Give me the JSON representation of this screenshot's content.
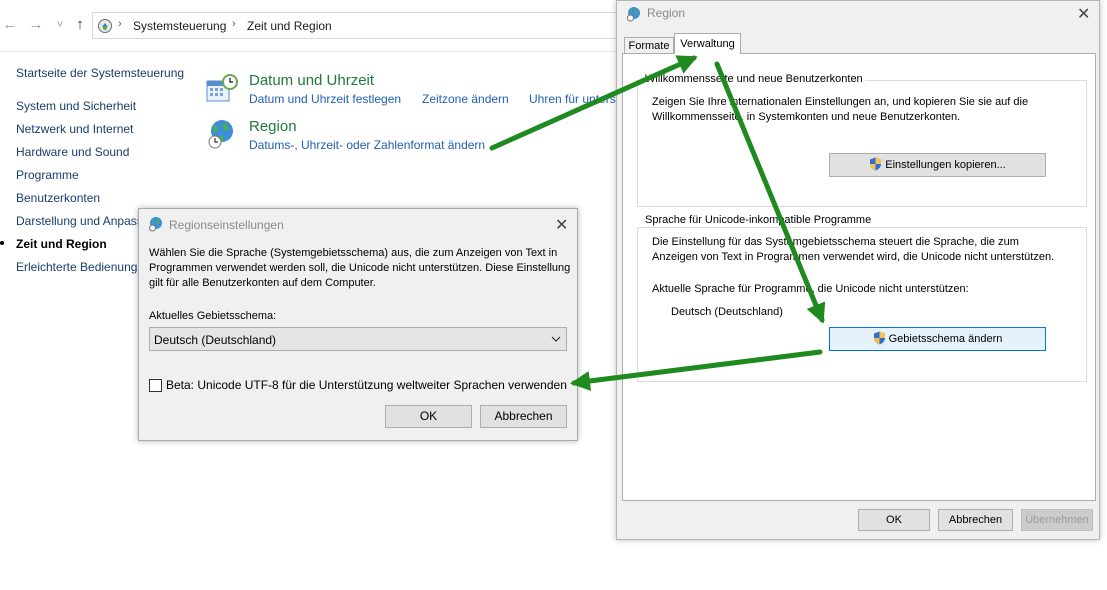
{
  "explorer": {
    "breadcrumb": [
      "Systemsteuerung",
      "Zeit und Region"
    ],
    "nav": {
      "back": "←",
      "forward": "→",
      "recent": "˅",
      "up": "↑"
    }
  },
  "sidebar": {
    "home": "Startseite der Systemsteuerung",
    "items": [
      "System und Sicherheit",
      "Netzwerk und Internet",
      "Hardware und Sound",
      "Programme",
      "Benutzerkonten",
      "Darstellung und Anpassung",
      "Zeit und Region",
      "Erleichterte Bedienung"
    ]
  },
  "categories": [
    {
      "title": "Datum und Uhrzeit",
      "links": [
        "Datum und Uhrzeit festlegen",
        "Zeitzone ändern",
        "Uhren für unterschiedliche Zeitzonen hinzufügen"
      ]
    },
    {
      "title": "Region",
      "links": [
        "Datums-, Uhrzeit- oder Zahlenformat ändern"
      ]
    }
  ],
  "region_dialog": {
    "title": "Region",
    "close": "✕",
    "tabs": [
      "Formate",
      "Verwaltung"
    ],
    "welcome": {
      "label": "Willkommensseite und neue Benutzerkonten",
      "text": "Zeigen Sie Ihre internationalen Einstellungen an, und kopieren Sie sie auf die Willkommensseite, in Systemkonten und neue Benutzerkonten.",
      "button": "Einstellungen kopieren..."
    },
    "unicode": {
      "label": "Sprache für Unicode-inkompatible Programme",
      "text": "Die Einstellung für das Systemgebietsschema steuert die Sprache, die zum Anzeigen von Text in Programmen verwendet wird, die Unicode nicht unterstützen.",
      "current_label": "Aktuelle Sprache für Programme, die Unicode nicht unterstützen:",
      "current_value": "Deutsch (Deutschland)",
      "button": "Gebietsschema ändern"
    },
    "buttons": {
      "ok": "OK",
      "cancel": "Abbrechen",
      "apply": "Übernehmen"
    }
  },
  "region_settings": {
    "title": "Regionseinstellungen",
    "close": "✕",
    "text": "Wählen Sie die Sprache (Systemgebietsschema) aus, die zum Anzeigen von Text in Programmen verwendet werden soll, die Unicode nicht unterstützen. Diese Einstellung gilt für alle Benutzerkonten auf dem Computer.",
    "locale_label": "Aktuelles Gebietsschema:",
    "locale_value": "Deutsch (Deutschland)",
    "beta_label": "Beta: Unicode UTF-8 für die Unterstützung weltweiter Sprachen verwenden",
    "buttons": {
      "ok": "OK",
      "cancel": "Abbrechen"
    }
  },
  "colors": {
    "annotation_arrow": "#1f8a1f",
    "link": "#1f5fb4",
    "category_title": "#1e7a3c"
  }
}
